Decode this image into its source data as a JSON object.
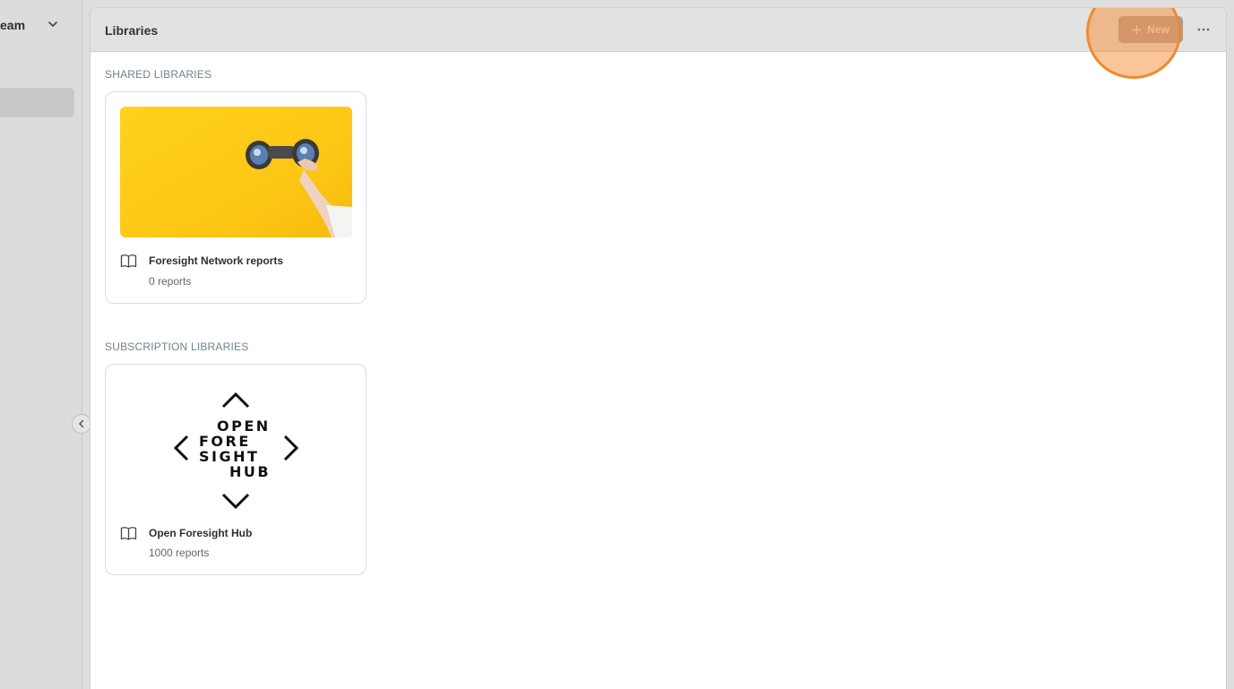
{
  "sidebar": {
    "team_label": "eam"
  },
  "header": {
    "title": "Libraries",
    "new_button_label": "New"
  },
  "sections": [
    {
      "heading": "SHARED LIBRARIES",
      "cards": [
        {
          "title": "Foresight Network reports",
          "subtitle": "0 reports",
          "image": "binoculars-on-yellow"
        }
      ]
    },
    {
      "heading": "SUBSCRIPTION LIBRARIES",
      "cards": [
        {
          "title": "Open Foresight Hub",
          "subtitle": "1000 reports",
          "image": "open-foresight-hub-logo",
          "logo_lines": [
            "OPEN",
            "FORE",
            "SIGHT",
            "HUB"
          ]
        }
      ]
    }
  ],
  "colors": {
    "accent_highlight": "#ef8a2f",
    "section_heading": "#6f8290",
    "card_image_yellow": "#ffcf1a"
  }
}
